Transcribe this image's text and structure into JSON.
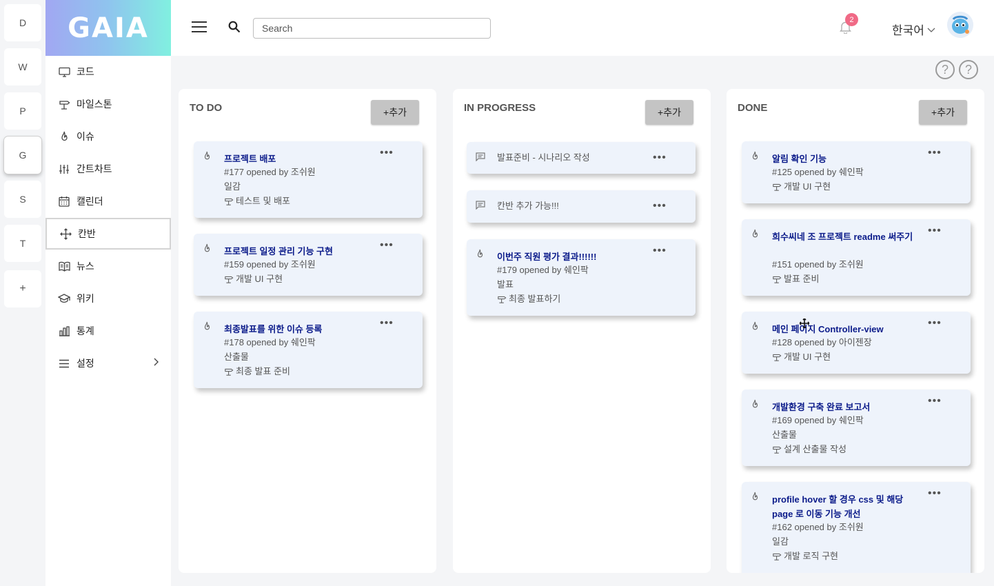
{
  "rail": {
    "items": [
      "D",
      "W",
      "P",
      "G",
      "S",
      "T",
      "+"
    ],
    "active": "G"
  },
  "logo": {
    "text": "GAIA"
  },
  "sidebar": {
    "items": [
      {
        "label": "코드",
        "icon": "monitor-icon"
      },
      {
        "label": "마일스톤",
        "icon": "milestone-icon"
      },
      {
        "label": "이슈",
        "icon": "flame-icon"
      },
      {
        "label": "간트차트",
        "icon": "sliders-icon"
      },
      {
        "label": "캘린더",
        "icon": "calendar-icon"
      },
      {
        "label": "칸반",
        "icon": "move-icon"
      },
      {
        "label": "뉴스",
        "icon": "book-icon"
      },
      {
        "label": "위키",
        "icon": "graduation-cap-icon"
      },
      {
        "label": "통계",
        "icon": "bar-chart-icon"
      },
      {
        "label": "설정",
        "icon": "menu-icon"
      }
    ],
    "active": "칸반"
  },
  "header": {
    "search_placeholder": "Search",
    "notification_count": "2",
    "language": "한국어"
  },
  "columns": [
    {
      "title": "TO DO",
      "add_label": "+추가",
      "cards": [
        {
          "title": "프로젝트 배포",
          "meta": "#177 opened by 조쉬원",
          "label": "일감",
          "milestone": "테스트 및 배포"
        },
        {
          "title": "프로젝트 일정 관리 기능 구현",
          "meta": "#159 opened by 조쉬원",
          "milestone": "개발 UI 구현"
        },
        {
          "title": "최종발표를 위한 이슈 등록",
          "meta": "#178 opened by 쉐인팍",
          "label": "산출물",
          "milestone": "최종 발표 준비"
        }
      ]
    },
    {
      "title": "IN PROGRESS",
      "add_label": "+추가",
      "cards": [
        {
          "note": "발표준비 - 시나리오 작성"
        },
        {
          "note": "칸반 추가 가능!!!"
        },
        {
          "title": "이번주 직원 평가 결과!!!!!!",
          "meta": "#179 opened by 쉐인팍",
          "label": "발표",
          "milestone": "최종 발표하기"
        }
      ]
    },
    {
      "title": "DONE",
      "add_label": "+추가",
      "cards": [
        {
          "title": "알림 확인 기능",
          "meta": "#125 opened by 쉐인팍",
          "milestone": "개발 UI 구현"
        },
        {
          "title": "희수씨네 조 프로젝트 readme 써주기",
          "meta": "#151 opened by 조쉬원",
          "milestone": "발표 준비"
        },
        {
          "title": "메인 페이지 Controller-view",
          "meta": "#128 opened by 아이젠장",
          "milestone": "개발 UI 구현"
        },
        {
          "title": "개발환경 구축 완료 보고서",
          "meta": "#169 opened by 쉐인팍",
          "label": "산출물",
          "milestone": "설계 산출물 작성"
        },
        {
          "title": "profile hover 할 경우 css 및 해당 page 로 이동 기능 개선",
          "meta": "#162 opened by 조쉬원",
          "label": "일감",
          "milestone": "개발 로직 구현"
        }
      ]
    }
  ]
}
